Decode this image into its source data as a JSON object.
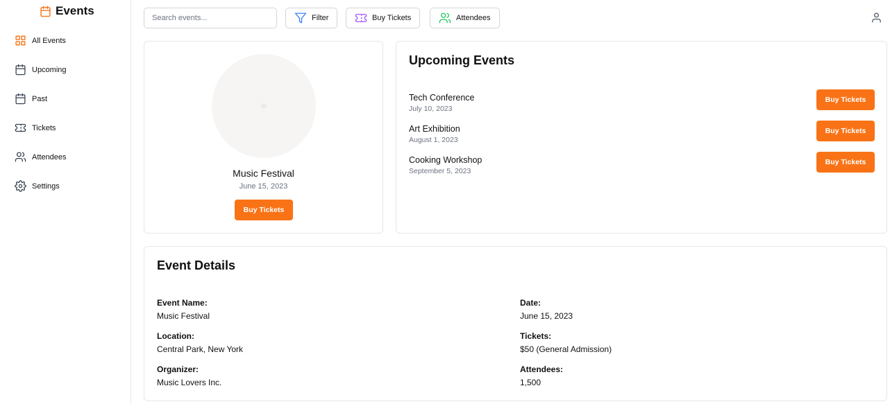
{
  "sidebar": {
    "title": "Events",
    "items": [
      {
        "label": "All Events",
        "icon": "grid-icon",
        "active": true
      },
      {
        "label": "Upcoming",
        "icon": "calendar-icon"
      },
      {
        "label": "Past",
        "icon": "calendar-icon"
      },
      {
        "label": "Tickets",
        "icon": "ticket-icon"
      },
      {
        "label": "Attendees",
        "icon": "users-icon"
      },
      {
        "label": "Settings",
        "icon": "gear-icon"
      }
    ]
  },
  "toolbar": {
    "search_placeholder": "Search events...",
    "filter_label": "Filter",
    "buy_tickets_label": "Buy Tickets",
    "attendees_label": "Attendees"
  },
  "featured": {
    "name": "Music Festival",
    "date": "June 15, 2023",
    "button": "Buy Tickets"
  },
  "upcoming": {
    "title": "Upcoming Events",
    "events": [
      {
        "name": "Tech Conference",
        "date": "July 10, 2023",
        "button": "Buy Tickets"
      },
      {
        "name": "Art Exhibition",
        "date": "August 1, 2023",
        "button": "Buy Tickets"
      },
      {
        "name": "Cooking Workshop",
        "date": "September 5, 2023",
        "button": "Buy Tickets"
      }
    ]
  },
  "details": {
    "title": "Event Details",
    "event_name_label": "Event Name:",
    "event_name": "Music Festival",
    "location_label": "Location:",
    "location": "Central Park, New York",
    "organizer_label": "Organizer:",
    "organizer": "Music Lovers Inc.",
    "date_label": "Date:",
    "date": "June 15, 2023",
    "tickets_label": "Tickets:",
    "tickets": "$50 (General Admission)",
    "attendees_label": "Attendees:",
    "attendees": "1,500"
  },
  "colors": {
    "accent": "#f97316",
    "filter_icon": "#3b82f6",
    "ticket_icon": "#a855f7",
    "attendees_icon": "#22c55e"
  }
}
